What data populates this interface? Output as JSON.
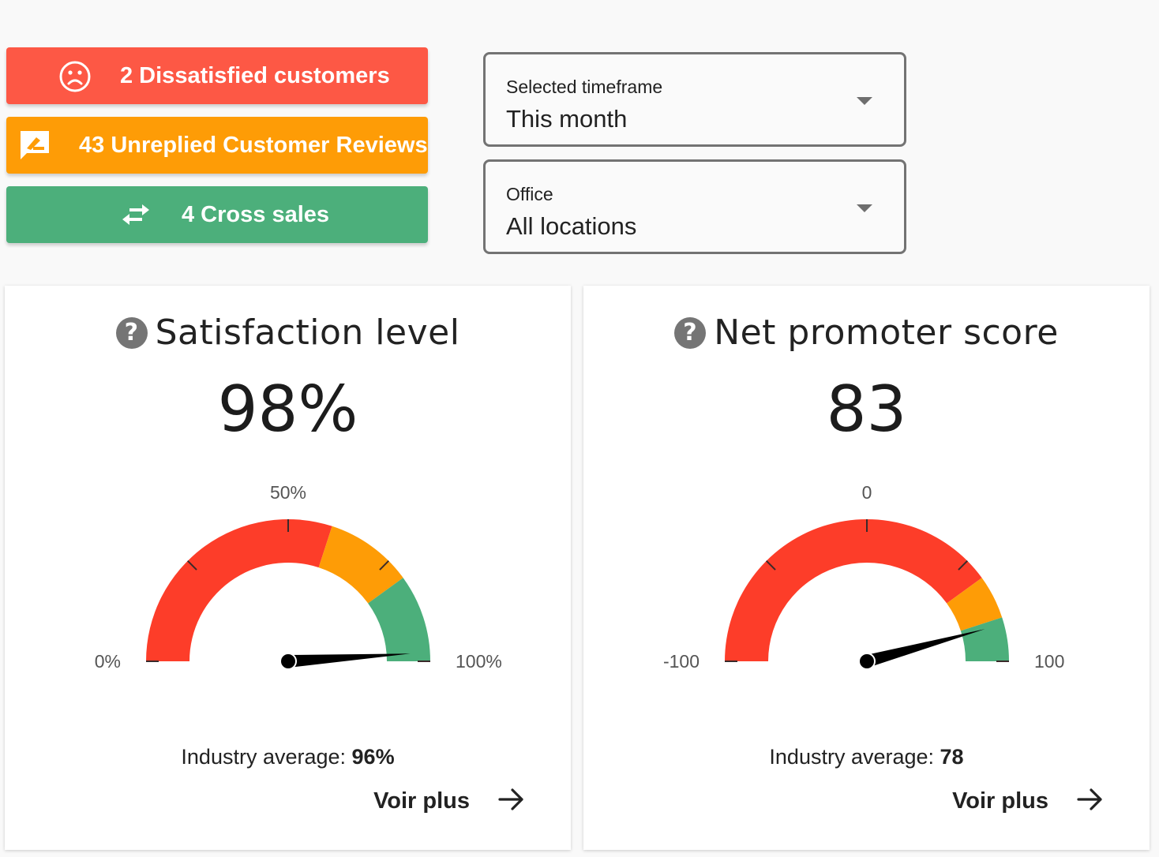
{
  "alerts": [
    {
      "label": "2 Dissatisfied customers",
      "icon": "sad-face-icon",
      "color": "#fd5845"
    },
    {
      "label": "43 Unreplied Customer Reviews",
      "icon": "rate-review-icon",
      "color": "#fe9c06"
    },
    {
      "label": "4 Cross sales",
      "icon": "swap-arrows-icon",
      "color": "#4caf7b"
    }
  ],
  "filters": {
    "timeframe": {
      "label": "Selected timeframe",
      "value": "This month"
    },
    "office": {
      "label": "Office",
      "value": "All locations"
    }
  },
  "cards": {
    "satisfaction": {
      "title": "Satisfaction level",
      "value_text": "98%",
      "industry_label": "Industry average: ",
      "industry_value": "96%",
      "more_label": "Voir plus"
    },
    "nps": {
      "title": "Net promoter score",
      "value_text": "83",
      "industry_label": "Industry average: ",
      "industry_value": "78",
      "more_label": "Voir plus"
    }
  },
  "colors": {
    "red": "#fd3d29",
    "orange": "#fe9c06",
    "green": "#4caf7b"
  },
  "chart_data": [
    {
      "type": "gauge",
      "title": "Satisfaction level",
      "min": 0,
      "max": 100,
      "value": 98,
      "min_label": "0%",
      "mid_label": "50%",
      "max_label": "100%",
      "bands": [
        {
          "from": 0,
          "to": 60,
          "color": "#fd3d29"
        },
        {
          "from": 60,
          "to": 80,
          "color": "#fe9c06"
        },
        {
          "from": 80,
          "to": 100,
          "color": "#4caf7b"
        }
      ],
      "ticks": [
        0,
        25,
        50,
        75,
        100
      ]
    },
    {
      "type": "gauge",
      "title": "Net promoter score",
      "min": -100,
      "max": 100,
      "value": 83,
      "min_label": "-100",
      "mid_label": "0",
      "max_label": "100",
      "bands": [
        {
          "from": -100,
          "to": 60,
          "color": "#fd3d29"
        },
        {
          "from": 60,
          "to": 80,
          "color": "#fe9c06"
        },
        {
          "from": 80,
          "to": 100,
          "color": "#4caf7b"
        }
      ],
      "ticks": [
        -100,
        -50,
        0,
        50,
        100
      ]
    }
  ]
}
